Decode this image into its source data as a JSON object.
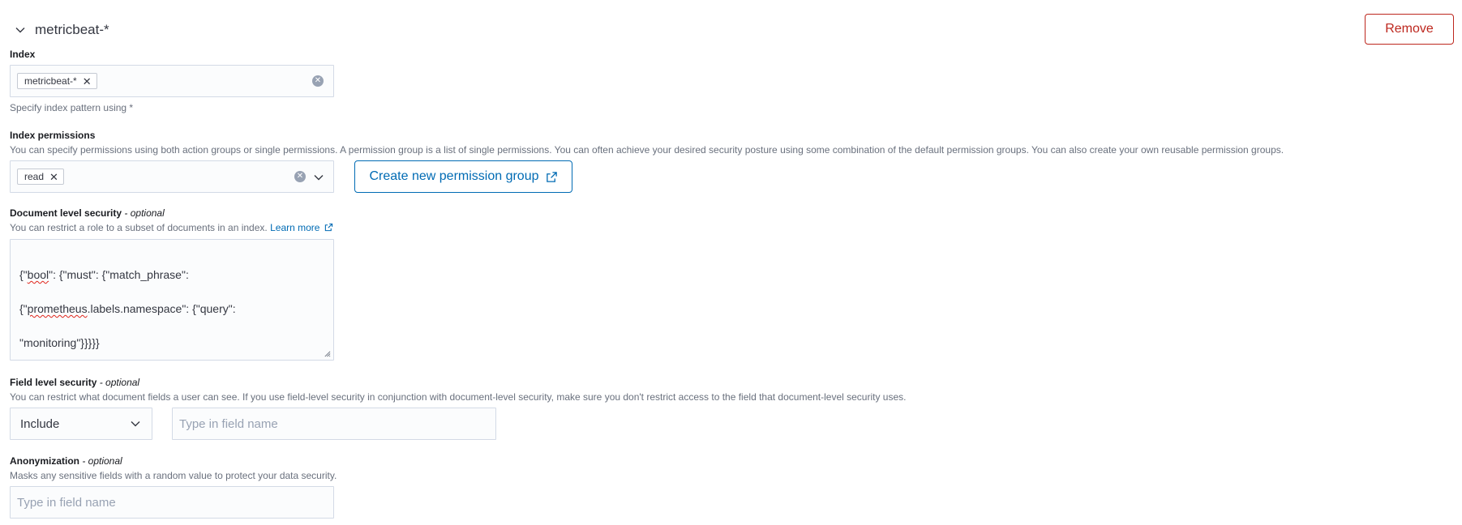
{
  "section": {
    "title": "metricbeat-*",
    "remove_label": "Remove"
  },
  "index": {
    "label": "Index",
    "pills": [
      "metricbeat-*"
    ],
    "help": "Specify index pattern using *"
  },
  "index_permissions": {
    "label": "Index permissions",
    "help": "You can specify permissions using both action groups or single permissions. A permission group is a list of single permissions. You can often achieve your desired security posture using some combination of the default permission groups. You can also create your own reusable permission groups.",
    "pills": [
      "read"
    ],
    "create_button_label": "Create new permission group"
  },
  "document_level_security": {
    "label": "Document level security",
    "optional": " - optional",
    "help": "You can restrict a role to a subset of documents in an index.",
    "learn_more": "Learn more",
    "query_lines": [
      {
        "pre": "{\"",
        "squiggle": "bool",
        "post": "\": {\"must\": {\"match_phrase\":"
      },
      {
        "pre": "{\"",
        "squiggle": "prometheus",
        "post": ".labels.namespace\": {\"query\":"
      },
      {
        "pre": "\"monitoring\"}}}}}",
        "squiggle": "",
        "post": ""
      }
    ]
  },
  "field_level_security": {
    "label": "Field level security",
    "optional": " - optional",
    "help": "You can restrict what document fields a user can see. If you use field-level security in conjunction with document-level security, make sure you don't restrict access to the field that document-level security uses.",
    "mode_value": "Include",
    "field_placeholder": "Type in field name"
  },
  "anonymization": {
    "label": "Anonymization",
    "optional": " - optional",
    "help": "Masks any sensitive fields with a random value to protect your data security.",
    "field_placeholder": "Type in field name"
  },
  "icons": {
    "collapse": "chevron-down-icon",
    "pill_remove": "cross-icon",
    "clear": "clear-circle-icon",
    "dropdown": "chevron-down-icon",
    "external": "external-link-icon",
    "resize": "resize-handle-icon"
  },
  "colors": {
    "danger": "#bd271e",
    "primary": "#006bb4",
    "muted_text": "#69707d",
    "field_bg": "#fbfcfd",
    "field_border": "#d3dae6"
  }
}
